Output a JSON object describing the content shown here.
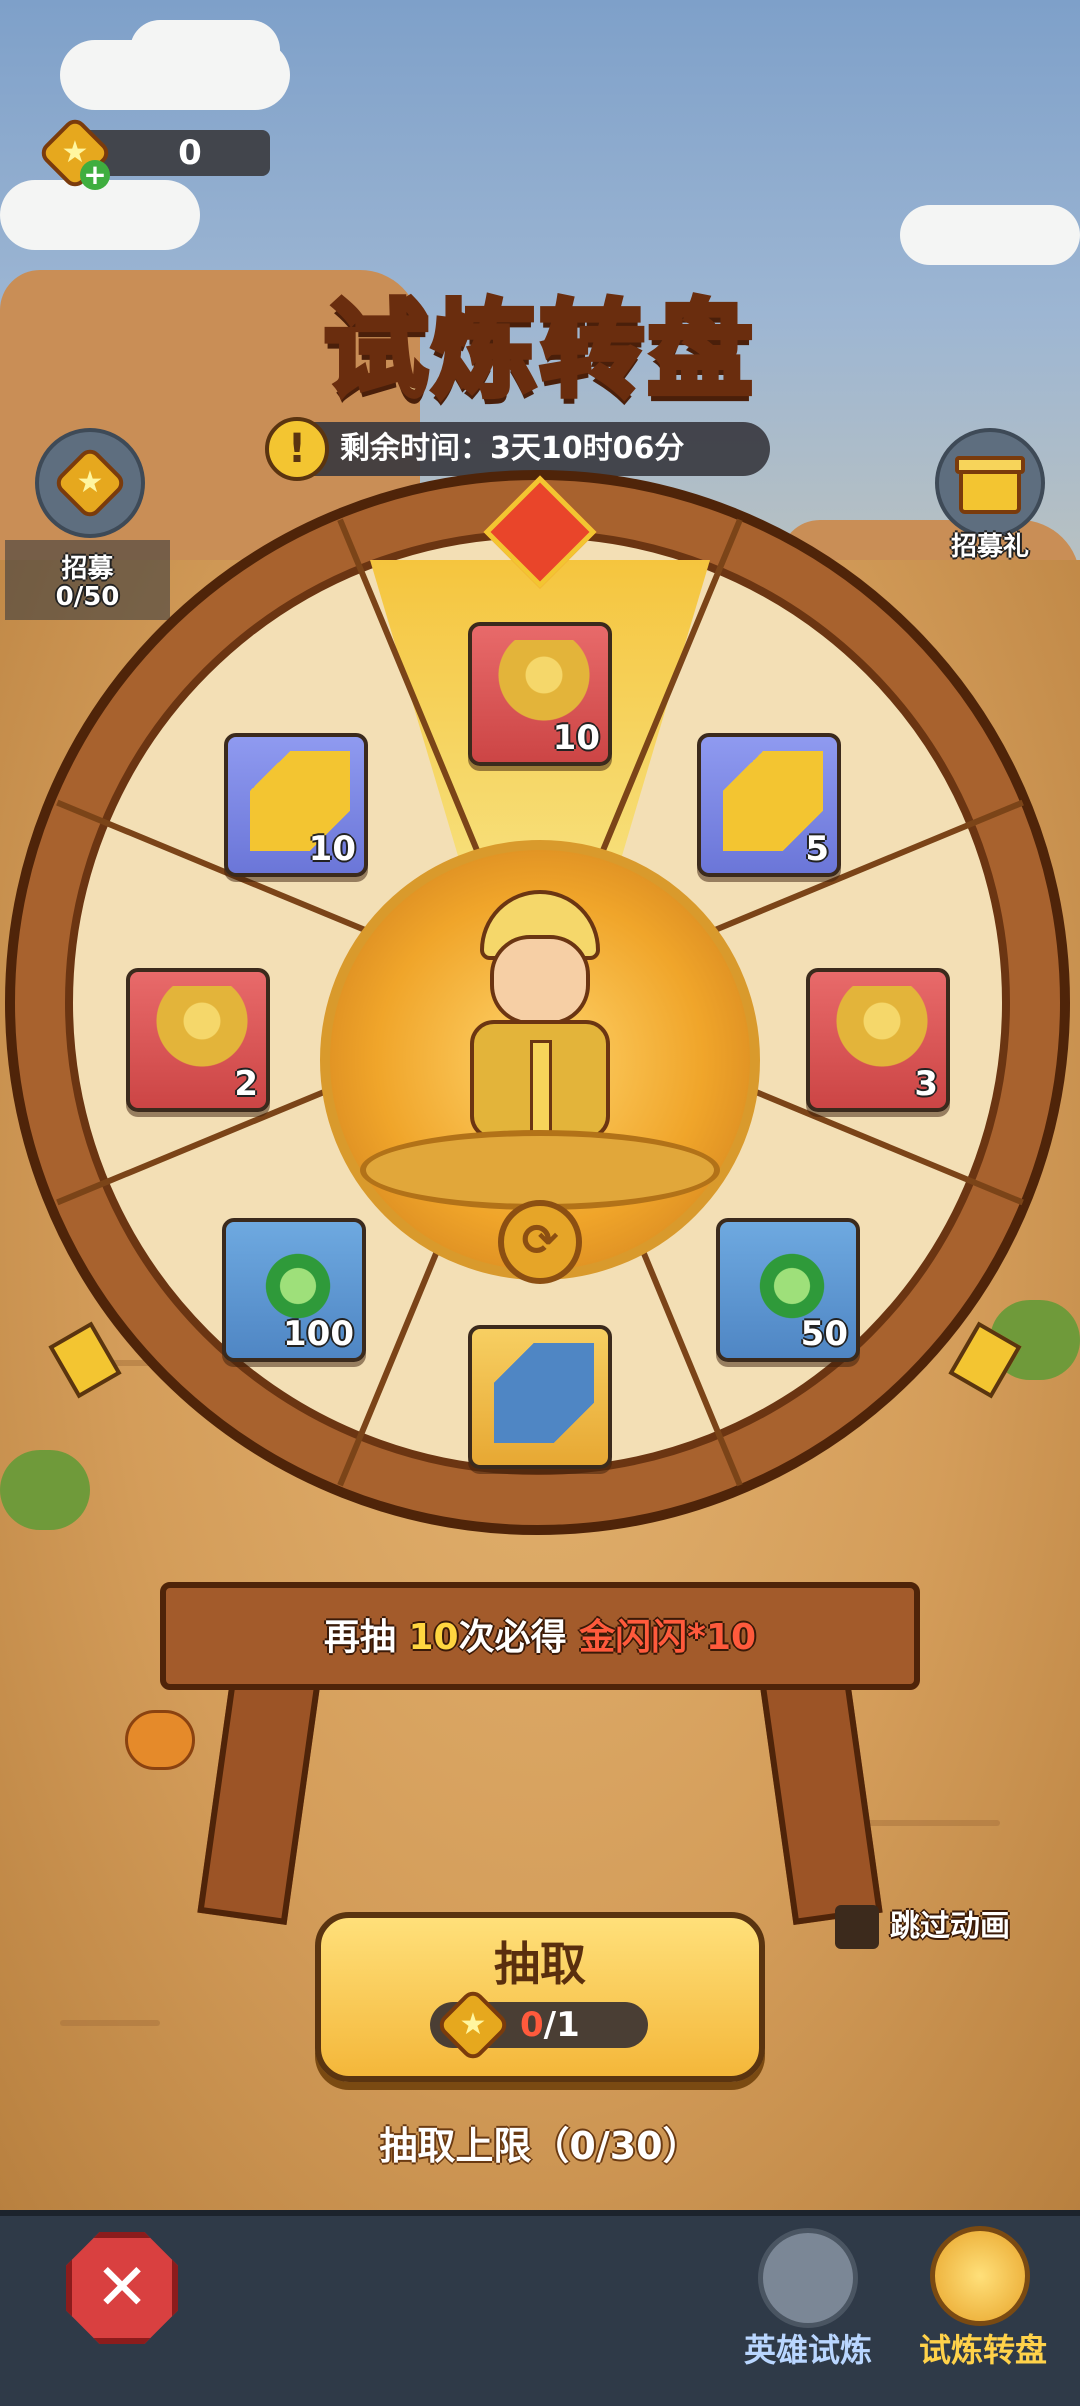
{
  "currency": {
    "value": "0",
    "icon": "star-gem-plus-icon"
  },
  "title": "试炼转盘",
  "timer": {
    "text": "剩余时间：3天10时06分",
    "icon": "exclamation-icon"
  },
  "recruit": {
    "label": "招募",
    "progress": "0/50",
    "icon": "star-gem-icon"
  },
  "gift": {
    "label": "招募礼",
    "icon": "gift-icon"
  },
  "wheel": {
    "items": [
      {
        "type": "hero-shard",
        "count": "10",
        "color": "red"
      },
      {
        "type": "ticket",
        "count": "5",
        "color": "blue"
      },
      {
        "type": "hero-shard",
        "count": "3",
        "color": "red"
      },
      {
        "type": "green-orb",
        "count": "50",
        "color": "teal"
      },
      {
        "type": "gold-ticket",
        "count": "",
        "color": "gold"
      },
      {
        "type": "green-orb",
        "count": "100",
        "color": "teal"
      },
      {
        "type": "hero-shard",
        "count": "2",
        "color": "red"
      },
      {
        "type": "ticket",
        "count": "10",
        "color": "blue"
      }
    ]
  },
  "pity": {
    "prefix": "再抽 ",
    "count": "10",
    "mid": "次必得 ",
    "reward": "金闪闪*10"
  },
  "skip": {
    "label": "跳过动画"
  },
  "draw": {
    "label": "抽取",
    "cost_current": "0",
    "cost_total": "/1"
  },
  "limit": "抽取上限（0/30）",
  "nav": {
    "tab1": {
      "label": "英雄试炼",
      "icon": "anvil-icon"
    },
    "tab2": {
      "label": "试炼转盘",
      "icon": "golden-wheel-icon"
    }
  },
  "colors": {
    "accent": "#f4b73a",
    "wood": "#a35b2b",
    "red": "#ff5a3c"
  }
}
